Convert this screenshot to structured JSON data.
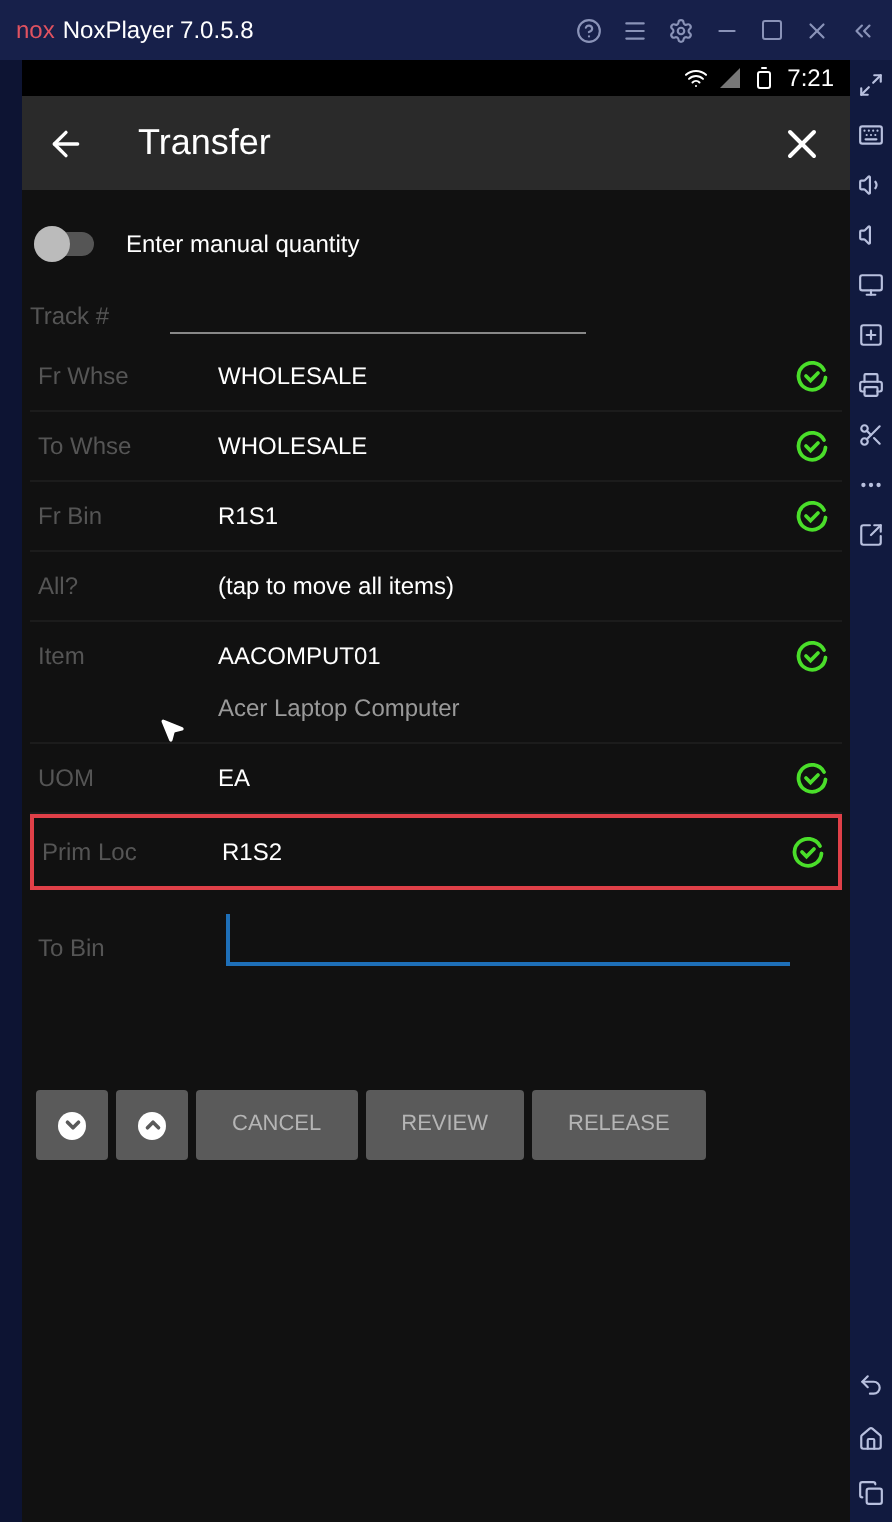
{
  "window": {
    "logo": "nox",
    "title": "NoxPlayer 7.0.5.8"
  },
  "status_bar": {
    "time": "7:21"
  },
  "app_bar": {
    "title": "Transfer"
  },
  "toggle": {
    "label": "Enter manual quantity",
    "on": false
  },
  "track_field": {
    "label": "Track #"
  },
  "rows": [
    {
      "label": "Fr Whse",
      "value": "WHOLESALE",
      "verified": true,
      "highlighted": false
    },
    {
      "label": "To Whse",
      "value": "WHOLESALE",
      "verified": true,
      "highlighted": false
    },
    {
      "label": "Fr Bin",
      "value": "R1S1",
      "verified": true,
      "highlighted": false
    },
    {
      "label": "All?",
      "value": "(tap to move all items)",
      "verified": false,
      "highlighted": false
    },
    {
      "label": "Item",
      "value": "AACOMPUT01",
      "subtext": "Acer Laptop Computer",
      "verified": true,
      "highlighted": false
    },
    {
      "label": "UOM",
      "value": "EA",
      "verified": true,
      "highlighted": false
    },
    {
      "label": "Prim Loc",
      "value": "R1S2",
      "verified": true,
      "highlighted": true
    }
  ],
  "to_bin_field": {
    "label": "To Bin",
    "focused": true
  },
  "buttons": [
    {
      "kind": "down"
    },
    {
      "kind": "up"
    },
    {
      "kind": "text",
      "label": "CANCEL"
    },
    {
      "kind": "text",
      "label": "REVIEW"
    },
    {
      "kind": "text",
      "label": "RELEASE"
    }
  ]
}
